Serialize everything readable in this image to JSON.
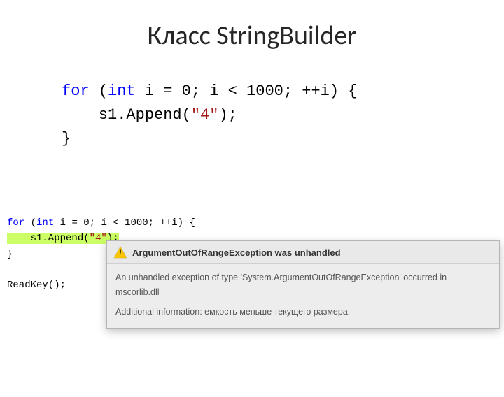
{
  "title": "Класс StringBuilder",
  "code_top": {
    "kw_for": "for",
    "paren_open": " (",
    "kw_int": "int",
    "after_int": " i = 0; i < 1000; ++i) {",
    "line2_prefix": "    s1.Append(",
    "str1": "\"4\"",
    "line2_suffix": ");",
    "line3": "}"
  },
  "editor": {
    "line1_kw_for": "for",
    "line1_paren": " (",
    "line1_kw_int": "int",
    "line1_rest": " i = 0; i < 1000; ++i) {",
    "line2_prefix": "    s1.Append(",
    "line2_str": "\"4\"",
    "line2_suffix": ");",
    "line3": "}",
    "line5": "ReadKey();"
  },
  "exception": {
    "title": "ArgumentOutOfRangeException was unhandled",
    "msg1": "An unhandled exception of type 'System.ArgumentOutOfRangeException' occurred in mscorlib.dll",
    "msg2": "Additional information: емкость меньше текущего размера."
  }
}
